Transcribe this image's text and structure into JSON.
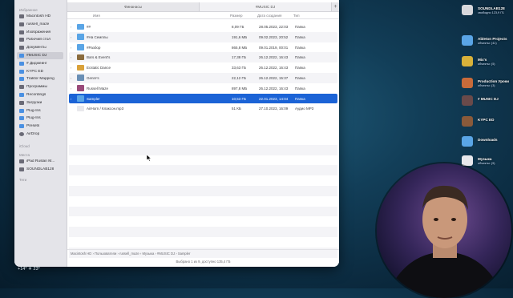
{
  "sidebar": {
    "favorites_heading": "Избранное",
    "favorites": [
      {
        "label": "Macintosh HD",
        "icon": "drive-icon"
      },
      {
        "label": "russell_maze",
        "icon": "home-icon"
      },
      {
        "label": "Изображения",
        "icon": "images-icon"
      },
      {
        "label": "Рабочий стол",
        "icon": "desktop-icon"
      },
      {
        "label": "Документы",
        "icon": "documents-icon"
      },
      {
        "label": "#MUSIC DJ",
        "icon": "folder-icon",
        "selected": true
      },
      {
        "label": "# Диджеинг",
        "icon": "folder-icon"
      },
      {
        "label": "KYPC ED",
        "icon": "folder-icon"
      },
      {
        "label": "Traktor Mapping",
        "icon": "folder-icon"
      },
      {
        "label": "Программы",
        "icon": "apps-icon"
      },
      {
        "label": "Recordings",
        "icon": "folder-icon"
      },
      {
        "label": "Загрузки",
        "icon": "downloads-icon"
      },
      {
        "label": "Plug-Ins",
        "icon": "folder-icon"
      },
      {
        "label": "Plug-Ins",
        "icon": "folder-icon"
      },
      {
        "label": "Presets",
        "icon": "folder-icon"
      },
      {
        "label": "AirDrop",
        "icon": "airdrop-icon"
      }
    ],
    "icloud_heading": "iCloud",
    "locations_heading": "Места",
    "locations": [
      {
        "label": "iPad Ruslan M...",
        "icon": "ipad-icon"
      },
      {
        "label": "SOUNDLAB128",
        "icon": "drive-icon"
      }
    ],
    "tags_heading": "Теги"
  },
  "tabs": {
    "tab1": "Финанасы",
    "tab2": "#MUSIC DJ",
    "add": "+"
  },
  "columns": {
    "name": "Имя",
    "size": "Размер",
    "date": "Дата создания",
    "kind": "Тип"
  },
  "files": [
    {
      "name": "##",
      "size": "8,09 ГБ",
      "date": "28.05.2023, 22:03",
      "kind": "Папка",
      "color": "#5aa5e6"
    },
    {
      "name": "#На Семплы",
      "size": "191,6 МБ",
      "date": "09.02.2023, 20:52",
      "kind": "Папка",
      "color": "#5aa5e6"
    },
    {
      "name": "#Разбор",
      "size": "865,8 МБ",
      "date": "09.01.2019, 00:01",
      "kind": "Папка",
      "color": "#5aa5e6"
    },
    {
      "name": "Bars & Event's",
      "size": "17,38 ГБ",
      "date": "26.12.2022, 16:43",
      "kind": "Папка",
      "color": "#8a6b3d"
    },
    {
      "name": "Ecstatic Dance",
      "size": "33,63 ГБ",
      "date": "26.12.2022, 16:43",
      "kind": "Папка",
      "color": "#d9a13a"
    },
    {
      "name": "Genre's",
      "size": "22,12 ГБ",
      "date": "26.12.2022, 15:37",
      "kind": "Папка",
      "color": "#6a8fb5"
    },
    {
      "name": "Russell Maze",
      "size": "897,8 МБ",
      "date": "26.12.2022, 16:43",
      "kind": "Папка",
      "color": "#9a4a7a"
    },
    {
      "name": "Sampler",
      "size": "10,53 ГБ",
      "date": "22.01.2023, 14:04",
      "kind": "Папка",
      "color": "#5aa5e6",
      "selected": true
    },
    {
      "name": "AirHorn / Клаксон.mp3",
      "size": "51 КБ",
      "date": "27.10.2023, 16:09",
      "kind": "Аудио MP3",
      "color": "#e8e8ec"
    }
  ],
  "pathbar": "Macintosh HD › Пользователи › russell_maze › Музыка › #MUSIC DJ › Sampler",
  "status": "Выбрано 1 из 9, доступно 135,4 ГБ",
  "desktop": [
    {
      "label": "SOUNDLAB128",
      "sub": "свободно 123,9 ГБ",
      "icon": "drive-icon",
      "color": "#d8d8dc"
    },
    {
      "label": "Ableton Projects",
      "sub": "объекты: (41)",
      "icon": "folder-icon",
      "color": "#5aa5e6"
    },
    {
      "label": "Mix's",
      "sub": "объекты: (5)",
      "icon": "vinyl-icon",
      "color": "#d9b23a"
    },
    {
      "label": "Production Уроки",
      "sub": "объекты: (3)",
      "icon": "folder-icon",
      "color": "#c96b3a"
    },
    {
      "label": "# MUSIC DJ",
      "sub": "",
      "icon": "avatar-folder-icon",
      "color": "#6a4a4a"
    },
    {
      "label": "KYPC ED",
      "sub": "",
      "icon": "avatar-folder-icon",
      "color": "#8a5a3a"
    },
    {
      "label": "Downloads",
      "sub": "",
      "icon": "downloads-folder-icon",
      "color": "#5aa5e6"
    },
    {
      "label": "Музыка",
      "sub": "объекты: (5)",
      "icon": "music-folder-icon",
      "color": "#e8e8ec"
    }
  ],
  "weather": "+14° ☀ 23°"
}
